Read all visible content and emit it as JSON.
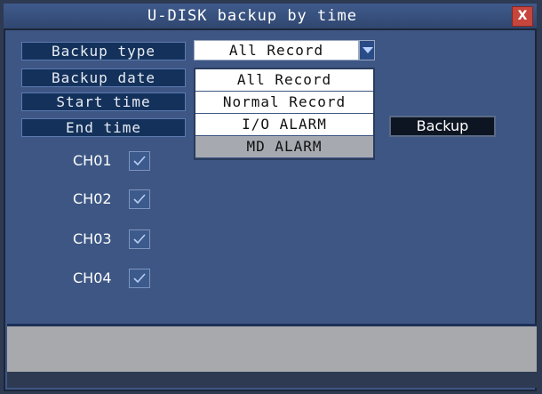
{
  "window": {
    "title": "U-DISK backup by time",
    "close_label": "X"
  },
  "labels": {
    "backup_type": "Backup type",
    "backup_date": "Backup date",
    "start_time": "Start time",
    "end_time": "End time"
  },
  "backup_type_select": {
    "value": "All Record",
    "options": [
      "All Record",
      "Normal Record",
      "I/O ALARM",
      "MD ALARM"
    ],
    "highlighted_option": "MD ALARM"
  },
  "backup_button": "Backup",
  "channels": [
    {
      "label": "CH01",
      "checked": true
    },
    {
      "label": "CH02",
      "checked": true
    },
    {
      "label": "CH03",
      "checked": true
    },
    {
      "label": "CH04",
      "checked": true
    }
  ],
  "colors": {
    "panel": "#3d5684",
    "label_bg": "#13315a",
    "close": "#c6453c",
    "status_bar": "#a7a9ad"
  }
}
